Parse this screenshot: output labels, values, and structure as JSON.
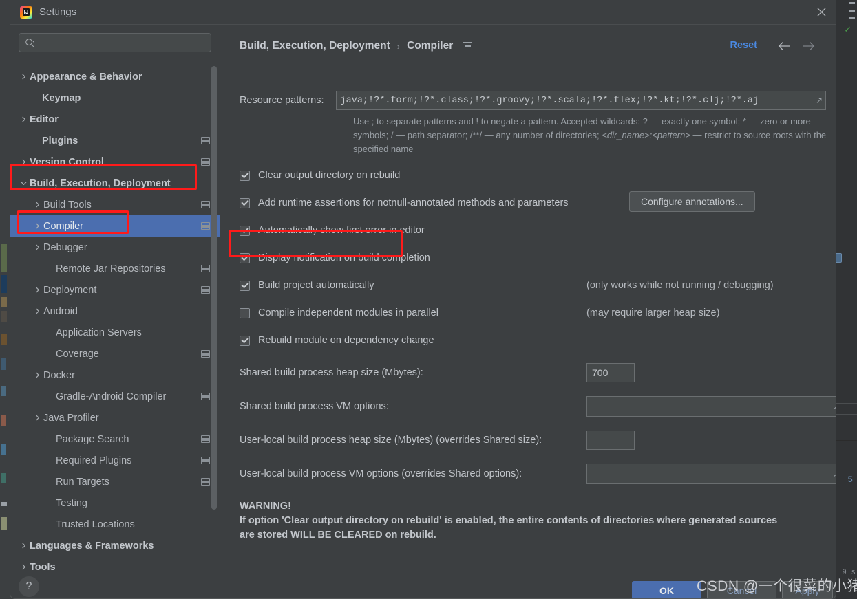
{
  "window": {
    "title": "Settings",
    "app_icon": "intellij-idea-icon",
    "close_icon": "close-icon"
  },
  "search": {
    "value": "",
    "placeholder": "",
    "icon": "search-icon"
  },
  "sidebar": {
    "items": [
      {
        "label": "Appearance & Behavior",
        "arrow": "chevron-right",
        "bold": true,
        "badge": false,
        "selected": false,
        "indent": 10
      },
      {
        "label": "Keymap",
        "arrow": "none",
        "bold": true,
        "badge": false,
        "selected": false,
        "indent": 28
      },
      {
        "label": "Editor",
        "arrow": "chevron-right",
        "bold": true,
        "badge": false,
        "selected": false,
        "indent": 10
      },
      {
        "label": "Plugins",
        "arrow": "none",
        "bold": true,
        "badge": true,
        "selected": false,
        "indent": 28
      },
      {
        "label": "Version Control",
        "arrow": "chevron-right",
        "bold": true,
        "badge": true,
        "selected": false,
        "indent": 10
      },
      {
        "label": "Build, Execution, Deployment",
        "arrow": "chevron-down",
        "bold": true,
        "badge": false,
        "selected": false,
        "indent": 10
      },
      {
        "label": "Build Tools",
        "arrow": "chevron-right",
        "bold": false,
        "badge": true,
        "selected": false,
        "indent": 30
      },
      {
        "label": "Compiler",
        "arrow": "chevron-right",
        "bold": false,
        "badge": true,
        "selected": true,
        "indent": 30
      },
      {
        "label": "Debugger",
        "arrow": "chevron-right",
        "bold": false,
        "badge": false,
        "selected": false,
        "indent": 30
      },
      {
        "label": "Remote Jar Repositories",
        "arrow": "none",
        "bold": false,
        "badge": true,
        "selected": false,
        "indent": 48
      },
      {
        "label": "Deployment",
        "arrow": "chevron-right",
        "bold": false,
        "badge": true,
        "selected": false,
        "indent": 30
      },
      {
        "label": "Android",
        "arrow": "chevron-right",
        "bold": false,
        "badge": false,
        "selected": false,
        "indent": 30
      },
      {
        "label": "Application Servers",
        "arrow": "none",
        "bold": false,
        "badge": false,
        "selected": false,
        "indent": 48
      },
      {
        "label": "Coverage",
        "arrow": "none",
        "bold": false,
        "badge": true,
        "selected": false,
        "indent": 48
      },
      {
        "label": "Docker",
        "arrow": "chevron-right",
        "bold": false,
        "badge": false,
        "selected": false,
        "indent": 30
      },
      {
        "label": "Gradle-Android Compiler",
        "arrow": "none",
        "bold": false,
        "badge": true,
        "selected": false,
        "indent": 48
      },
      {
        "label": "Java Profiler",
        "arrow": "chevron-right",
        "bold": false,
        "badge": false,
        "selected": false,
        "indent": 30
      },
      {
        "label": "Package Search",
        "arrow": "none",
        "bold": false,
        "badge": true,
        "selected": false,
        "indent": 48
      },
      {
        "label": "Required Plugins",
        "arrow": "none",
        "bold": false,
        "badge": true,
        "selected": false,
        "indent": 48
      },
      {
        "label": "Run Targets",
        "arrow": "none",
        "bold": false,
        "badge": true,
        "selected": false,
        "indent": 48
      },
      {
        "label": "Testing",
        "arrow": "none",
        "bold": false,
        "badge": false,
        "selected": false,
        "indent": 48
      },
      {
        "label": "Trusted Locations",
        "arrow": "none",
        "bold": false,
        "badge": false,
        "selected": false,
        "indent": 48
      },
      {
        "label": "Languages & Frameworks",
        "arrow": "chevron-right",
        "bold": true,
        "badge": false,
        "selected": false,
        "indent": 10
      },
      {
        "label": "Tools",
        "arrow": "chevron-right",
        "bold": true,
        "badge": false,
        "selected": false,
        "indent": 10
      }
    ]
  },
  "header": {
    "crumb1": "Build, Execution, Deployment",
    "crumb_sep": "›",
    "crumb2": "Compiler",
    "reset_label": "Reset",
    "back_icon": "arrow-left-icon",
    "forward_icon": "arrow-right-icon",
    "badge_icon": "project-scope-icon"
  },
  "main": {
    "resource_patterns": {
      "label": "Resource patterns:",
      "value": "java;!?*.form;!?*.class;!?*.groovy;!?*.scala;!?*.flex;!?*.kt;!?*.clj;!?*.aj",
      "hint_part1": "Use ; to separate patterns and ! to negate a pattern. Accepted wildcards: ? — exactly one symbol; * — zero or more symbols; / — path separator; /**/ — any number of directories; ",
      "hint_dirname": "<dir_name>:<pattern>",
      "hint_part2": " — restrict to source roots with the specified name"
    },
    "options": [
      {
        "label": "Clear output directory on rebuild",
        "checked": true,
        "note": ""
      },
      {
        "label": "Add runtime assertions for notnull-annotated methods and parameters",
        "checked": true,
        "note": ""
      },
      {
        "label": "Automatically show first error in editor",
        "checked": true,
        "note": ""
      },
      {
        "label": "Display notification on build completion",
        "checked": true,
        "note": ""
      },
      {
        "label": "Build project automatically",
        "checked": true,
        "note": "(only works while not running / debugging)"
      },
      {
        "label": "Compile independent modules in parallel",
        "checked": false,
        "note": "(may require larger heap size)"
      },
      {
        "label": "Rebuild module on dependency change",
        "checked": true,
        "note": ""
      }
    ],
    "configure_annotations_label": "Configure annotations...",
    "fields": [
      {
        "label": "Shared build process heap size (Mbytes):",
        "value": "700",
        "kind": "small"
      },
      {
        "label": "Shared build process VM options:",
        "value": "",
        "kind": "wide"
      },
      {
        "label": "User-local build process heap size (Mbytes) (overrides Shared size):",
        "value": "",
        "kind": "small"
      },
      {
        "label": "User-local build process VM options (overrides Shared options):",
        "value": "",
        "kind": "wide"
      }
    ],
    "warning": {
      "line1": "WARNING!",
      "line2": "If option 'Clear output directory on rebuild' is enabled, the entire contents of directories where generated sources",
      "line3": "are stored WILL BE CLEARED on rebuild."
    }
  },
  "footer": {
    "help_label": "?",
    "ok_label": "OK",
    "cancel_label": "Cancel",
    "apply_label": "Apply"
  },
  "watermark": {
    "text": "CSDN @一个很菜的小猪"
  },
  "ide_background": {
    "right_number": "5",
    "right_text": "9\ns"
  },
  "colors": {
    "dialog_bg": "#3c3f41",
    "selection_blue": "#4b6eaf",
    "link_blue": "#4a88e0",
    "annotation_red": "#ff1a1a",
    "text_primary": "#c0c4c9",
    "text_secondary": "#9aa0a6"
  }
}
